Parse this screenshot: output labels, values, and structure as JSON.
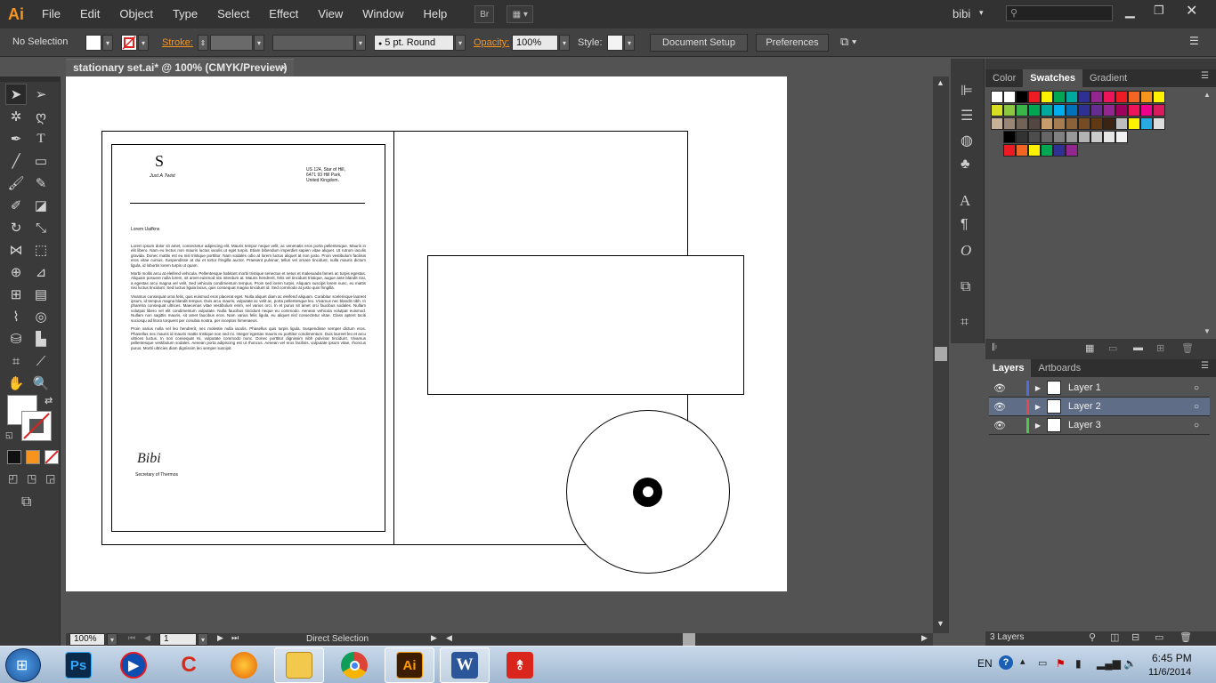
{
  "menubar": {
    "logo": "Ai",
    "items": [
      "File",
      "Edit",
      "Object",
      "Type",
      "Select",
      "Effect",
      "View",
      "Window",
      "Help"
    ],
    "bridge_label": "Br",
    "user": "bibi",
    "search_placeholder": ""
  },
  "control": {
    "selection": "No Selection",
    "stroke_label": "Stroke:",
    "brush": "5 pt. Round",
    "opacity_label": "Opacity:",
    "opacity_value": "100%",
    "style_label": "Style:",
    "document_setup": "Document Setup",
    "preferences": "Preferences"
  },
  "document": {
    "tab_title": "stationary set.ai* @ 100% (CMYK/Preview)",
    "close": "×"
  },
  "letter": {
    "logo_letter": "S",
    "logo_sub": "Just A Twist",
    "address_line1": "US 124, Star of Hill,",
    "address_line2": "6471 93 Hill Park,",
    "address_line3": "United Kingdom.",
    "greeting": "Lorem Uaifkns",
    "para1": "Lorem ipsum dolor sit amet, consectetur adipiscing elit. Mauris tempor neque velit, ac venenatis eros porta pellentesque. Mauris in elit libero. Nam eu lectus non mauris luctus iaculis ut eget turpis. Etiam bibendum imperdiet sapien vitae aliquet. Ut rutrum iaculis gravida. Donec mattis est eu nisl tristique porttitor. Nam sodales odio at lorem luctus aliquet at non justo. Proin vestibulum facilisis eros vitae cursus. Suspendisse at dui et tortor fringilla auctor. Praesent pulvinar, tellus vel ornare tincidunt, nulla mauris dictum ligula, id lobortis lorem turpis ut quam.",
    "para2": "Morbi mollis arcu at eleifend vehicula. Pellentesque habitant morbi tristique senectus et netus et malesuada fames ac turpis egestas. Aliquam posuere nulla lorem, sit amet euismod nisi interdum at. Mauris hendrerit, felis vel tincidunt tristique, augue ante blandit nisi, a egestas arcu magna vel velit. Sed vehicula condimentum tempus. Proin sed lorem turpis. Aliquam suscipit lorem nunc, eu mattis nisi luctus tincidunt. Sed luctus ligula lacus, quis consequat magna tincidunt id. Sed commodo at justo quis fringilla.",
    "para3": "Vivamus consequat urna felis, quis euismod eros placerat eget. Nulla aliquet diam ac eleifend aliquam. Curabitur scelerisque laoreet ipsum, id tempus magna blandit tempus. Duis arcu mauris, vulputate ac velit ac, porta pellentesque leo. Vivamus nec blandit nibh. In pharetra consequat ultrices. Maecenas vitae vestibulum enim, vel varius orci. In et purus sit amet orci faucibus sodales. Nullam volutpat libero vel elit condimentum vulputate. Nulla faucibus tincidunt neque eu commodo. Aenean vehicula volutpat euismod. Nullam non sagittis mauris, sit amet faucibus eros. Nam varius felis ligula, eu aliquet nisl consectetur vitae. Class aptent taciti sociosqu ad litora torquent per conubia nostra, per inceptos himenaeos.",
    "para4": "Proin varius nulla vel leo hendrerit, nec molestie nulla iaculis. Phasellus quis turpis ligula. Suspendisse semper dictum eros. Phasellus nec mauris id mauris mattis tristique non sed mi. Integer egestas mauris eu porttitor condimentum. Duis laoreet leo et arcu ultrices luctus. In non consequat mi, vulputate commodo nunc. Donec porttitor dignissim nibh pulvinar tincidunt. Vivamus pellentesque vestibulum sodales. Aenean porta adipiscing est ut rhoncus. Aenean vel eros facilisis, vulputate ipsum vitae, rhoncus purus. Morbi ultricies diam dignissim leo semper suscipit.",
    "signature": "Bibi",
    "signer_title": "Secretary of Thermos"
  },
  "status": {
    "zoom": "100%",
    "page": "1",
    "tool": "Direct Selection"
  },
  "swatch_panel": {
    "tabs": [
      "Color",
      "Swatches",
      "Gradient"
    ],
    "active_tab": "Swatches",
    "rows": [
      [
        "#ffffff",
        "#ffffff",
        "#000000",
        "#ed1c24",
        "#fff200",
        "#00a651",
        "#00a99d",
        "#2e3192",
        "#92278f",
        "#ed145b",
        "#ed1c24",
        "#f26522",
        "#f7941d",
        "#fff200"
      ],
      [
        "#d7df23",
        "#8dc63f",
        "#39b54a",
        "#00a651",
        "#00a99d",
        "#00aeef",
        "#0072bc",
        "#2e3192",
        "#662d91",
        "#92278f",
        "#9e005d",
        "#ed145b",
        "#ec008c",
        "#d91a5d"
      ],
      [
        "#c7b299",
        "#998675",
        "#736357",
        "#534741",
        "#c69c6d",
        "#a67c52",
        "#8c6239",
        "#754c24",
        "#603913",
        "#3c2415",
        "#bcbec0",
        "#fff200",
        "#29abe2",
        "#dddddd"
      ],
      [
        "#000000",
        "#333333",
        "#4d4d4d",
        "#666666",
        "#808080",
        "#999999",
        "#b3b3b3",
        "#cccccc",
        "#e6e6e6",
        "#f2f2f2"
      ],
      [
        "#ed1c24",
        "#f26522",
        "#fff200",
        "#00a651",
        "#2e3192",
        "#92278f"
      ]
    ]
  },
  "layers_panel": {
    "tabs": [
      "Layers",
      "Artboards"
    ],
    "layers": [
      {
        "name": "Layer 1",
        "color": "#4d6edb"
      },
      {
        "name": "Layer 2",
        "color": "#e8454d"
      },
      {
        "name": "Layer 3",
        "color": "#4ec94e"
      }
    ],
    "count": "3 Layers"
  },
  "taskbar": {
    "apps": [
      "Ps",
      "Media Player",
      "CCleaner",
      "Firefox",
      "Explorer",
      "Chrome",
      "Ai",
      "W",
      "Acrobat"
    ],
    "lang": "EN",
    "time": "6:45 PM",
    "date": "11/6/2014"
  }
}
